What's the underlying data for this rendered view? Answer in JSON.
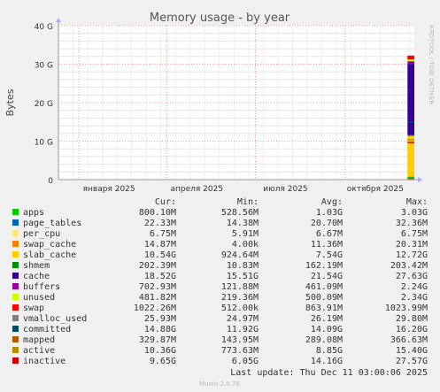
{
  "chart_data": {
    "type": "area",
    "title": "Memory usage - by year",
    "ylabel": "Bytes",
    "watermark": "RRDTOOL / TOBI OETIKER",
    "y_ticks": [
      "0",
      "10 G",
      "20 G",
      "30 G",
      "40 G"
    ],
    "ylim": [
      0,
      40
    ],
    "y_unit": "G",
    "x_ticks": [
      "января 2025",
      "апреля 2025",
      "июля 2025",
      "октября 2025"
    ],
    "grid": true,
    "x_start": "2024-12-11",
    "x_end": "2025-12-11",
    "x_tick_dates": [
      "2025-01-01",
      "2025-04-01",
      "2025-07-01",
      "2025-10-01"
    ],
    "data_start": "2025-12-04",
    "legend_header": {
      "cur": "Cur:",
      "min": "Min:",
      "avg": "Avg:",
      "max": "Max:"
    },
    "series": [
      {
        "name": "apps",
        "color": "#00cc00",
        "cur": "800.10M",
        "min": "528.56M",
        "avg": "1.03G",
        "max": "3.03G"
      },
      {
        "name": "page_tables",
        "color": "#0066b3",
        "cur": "22.33M",
        "min": "14.38M",
        "avg": "20.70M",
        "max": "32.36M"
      },
      {
        "name": "per_cpu",
        "color": "#ffe680",
        "cur": "6.75M",
        "min": "5.91M",
        "avg": "6.67M",
        "max": "6.75M"
      },
      {
        "name": "swap_cache",
        "color": "#ff8000",
        "cur": "14.87M",
        "min": "4.00k",
        "avg": "11.36M",
        "max": "20.31M"
      },
      {
        "name": "slab_cache",
        "color": "#ffcc00",
        "cur": "10.54G",
        "min": "924.64M",
        "avg": "7.54G",
        "max": "12.72G"
      },
      {
        "name": "shmem",
        "color": "#008f00",
        "cur": "202.39M",
        "min": "10.83M",
        "avg": "162.19M",
        "max": "203.42M"
      },
      {
        "name": "cache",
        "color": "#330099",
        "cur": "18.52G",
        "min": "15.51G",
        "avg": "21.54G",
        "max": "27.63G"
      },
      {
        "name": "buffers",
        "color": "#990099",
        "cur": "702.93M",
        "min": "121.88M",
        "avg": "461.09M",
        "max": "2.24G"
      },
      {
        "name": "unused",
        "color": "#ccff00",
        "cur": "481.82M",
        "min": "219.36M",
        "avg": "500.09M",
        "max": "2.34G"
      },
      {
        "name": "swap",
        "color": "#ff0000",
        "cur": "1022.26M",
        "min": "512.00k",
        "avg": "863.91M",
        "max": "1023.99M"
      },
      {
        "name": "vmalloc_used",
        "color": "#808080",
        "cur": "25.93M",
        "min": "24.97M",
        "avg": "26.19M",
        "max": "29.80M"
      },
      {
        "name": "committed",
        "color": "#004d66",
        "cur": "14.88G",
        "min": "11.92G",
        "avg": "14.09G",
        "max": "16.20G"
      },
      {
        "name": "mapped",
        "color": "#b35900",
        "cur": "329.87M",
        "min": "143.95M",
        "avg": "289.08M",
        "max": "366.63M"
      },
      {
        "name": "active",
        "color": "#b38f00",
        "cur": "10.36G",
        "min": "773.63M",
        "avg": "8.85G",
        "max": "15.40G"
      },
      {
        "name": "inactive",
        "color": "#cc0000",
        "cur": "9.65G",
        "min": "6.05G",
        "avg": "14.16G",
        "max": "27.57G"
      }
    ],
    "last_update": "Last update: Thu Dec 11 03:00:06 2025",
    "footer": "Munin 2.0.76"
  }
}
